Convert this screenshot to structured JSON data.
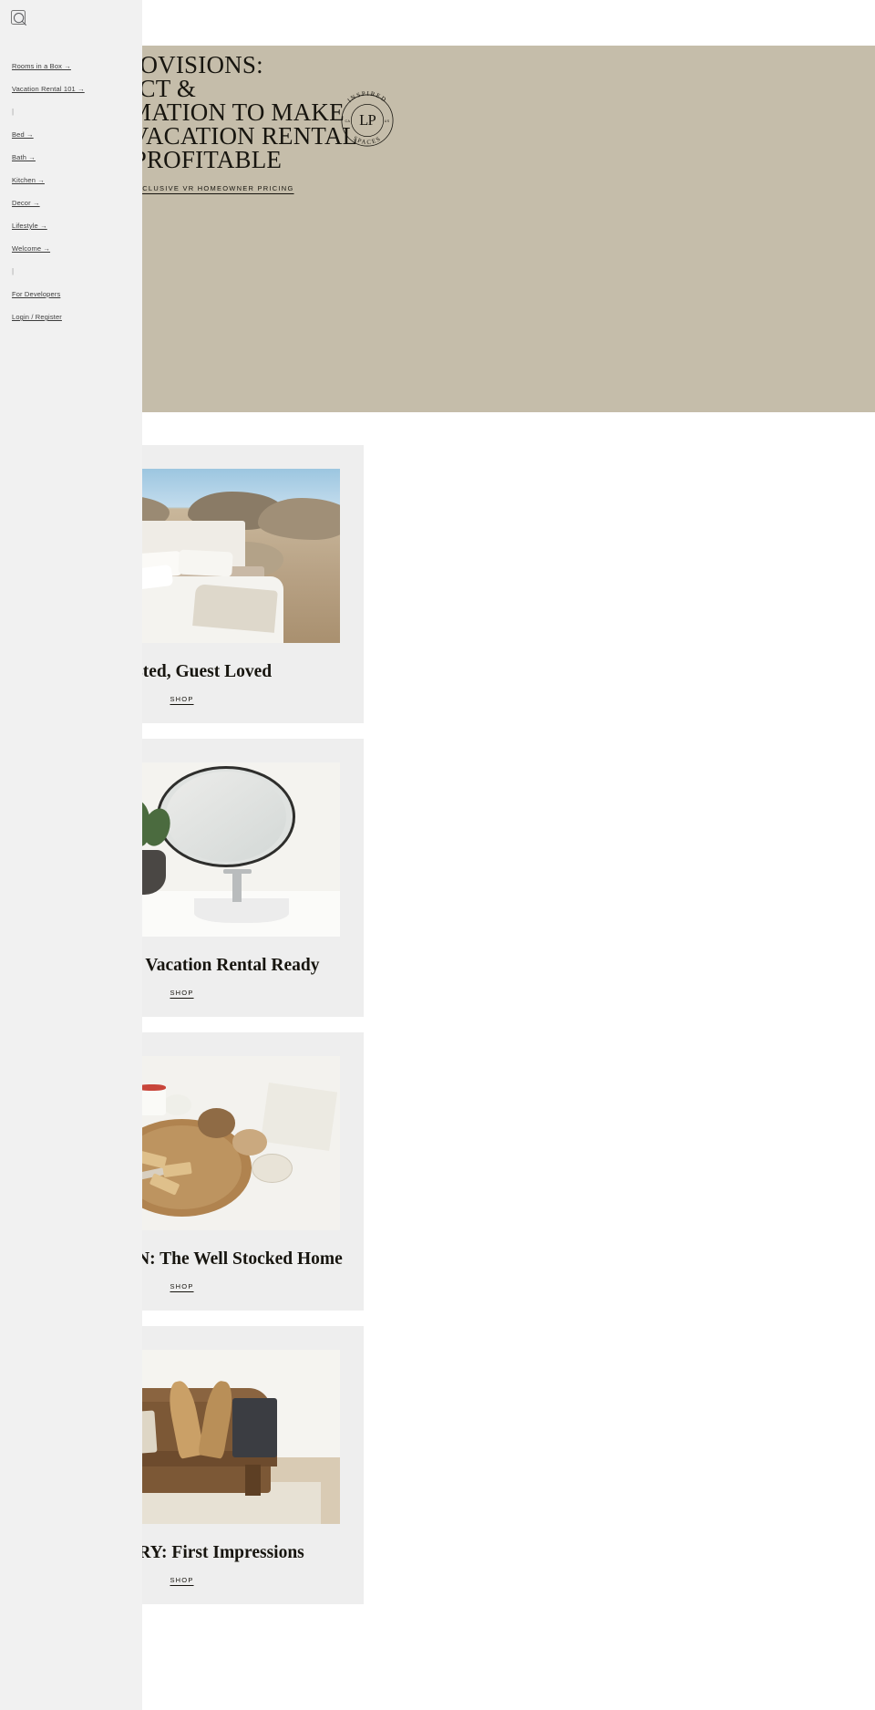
{
  "sidebar": {
    "search_icon": "search-icon",
    "items": [
      {
        "label": "Rooms in a Box →",
        "type": "link"
      },
      {
        "label": "Vacation Rental 101 →",
        "type": "link"
      },
      {
        "label": "|",
        "type": "divider"
      },
      {
        "label": "Bed →",
        "type": "link"
      },
      {
        "label": "Bath →",
        "type": "link"
      },
      {
        "label": "Kitchen →",
        "type": "link"
      },
      {
        "label": "Decor →",
        "type": "link"
      },
      {
        "label": "Lifestyle →",
        "type": "link"
      },
      {
        "label": "Welcome →",
        "type": "link"
      },
      {
        "label": "|",
        "type": "divider"
      },
      {
        "label": "For Developers",
        "type": "link"
      },
      {
        "label": "Login / Register",
        "type": "link"
      }
    ]
  },
  "hero": {
    "background_color": "#c5bdaa",
    "title": "THE PROVISIONS:\nPRODUCT &\nINFORMATION TO MAKE\nYOUR VACATION RENTAL\nMORE PROFITABLE",
    "cta_label": "CLICK HERE FOR EXCLUSIVE VR HOMEOWNER PRICING",
    "logo": {
      "top_text": "INSPIRED",
      "bottom_text": "SPACES",
      "monogram": "LP",
      "left_mark": "CA",
      "right_mark": "US"
    }
  },
  "cards": [
    {
      "title": "LP Tested, Guest Loved",
      "shop_label": "SHOP",
      "image_name": "bed-in-desert-photo",
      "image_style": "desert"
    },
    {
      "title": "THE BATH: Vacation Rental Ready",
      "shop_label": "SHOP",
      "image_name": "bathroom-vanity-mirror-photo",
      "image_style": "bath"
    },
    {
      "title": "THE KITCHEN: The Well Stocked Home",
      "shop_label": "SHOP",
      "image_name": "charcuterie-flatlay-photo",
      "image_style": "food"
    },
    {
      "title": "THE ENTRY: First Impressions",
      "shop_label": "SHOP",
      "image_name": "entry-bench-photo",
      "image_style": "bench"
    }
  ],
  "colors": {
    "sidebar_bg": "#f1f1f1",
    "hero_bg": "#c5bdaa",
    "card_bg": "#eeeeee",
    "text": "#17150f",
    "nav_text": "#3d3d3d"
  }
}
